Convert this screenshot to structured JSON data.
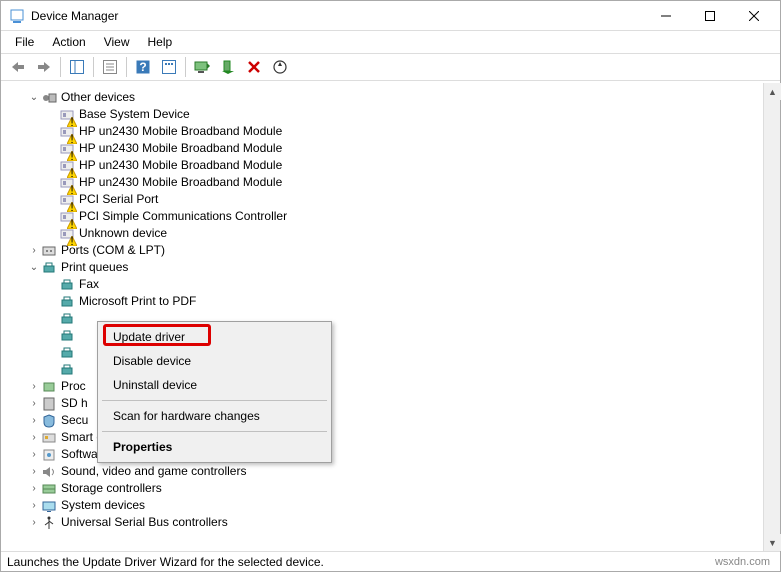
{
  "window": {
    "title": "Device Manager"
  },
  "menu": {
    "file": "File",
    "action": "Action",
    "view": "View",
    "help": "Help"
  },
  "tree": {
    "other_devices": {
      "label": "Other devices",
      "expanded": true,
      "items": [
        "Base System Device",
        "HP un2430 Mobile Broadband Module",
        "HP un2430 Mobile Broadband Module",
        "HP un2430 Mobile Broadband Module",
        "HP un2430 Mobile Broadband Module",
        "PCI Serial Port",
        "PCI Simple Communications Controller",
        "Unknown device"
      ]
    },
    "ports": {
      "label": "Ports (COM & LPT)",
      "expanded": false
    },
    "print_queues": {
      "label": "Print queues",
      "expanded": true,
      "items": [
        "Fax",
        "Microsoft Print to PDF",
        "",
        "",
        "",
        ""
      ]
    },
    "processors": {
      "label": "Proc"
    },
    "sd": {
      "label": "SD h"
    },
    "security": {
      "label": "Secu"
    },
    "smart_card": {
      "label": "Smart card readers"
    },
    "software": {
      "label": "Software devices"
    },
    "sound": {
      "label": "Sound, video and game controllers"
    },
    "storage": {
      "label": "Storage controllers"
    },
    "system": {
      "label": "System devices"
    },
    "usb": {
      "label": "Universal Serial Bus controllers"
    }
  },
  "context_menu": {
    "update_driver": "Update driver",
    "disable_device": "Disable device",
    "uninstall_device": "Uninstall device",
    "scan": "Scan for hardware changes",
    "properties": "Properties"
  },
  "status": "Launches the Update Driver Wizard for the selected device.",
  "watermark": "wsxdn.com"
}
